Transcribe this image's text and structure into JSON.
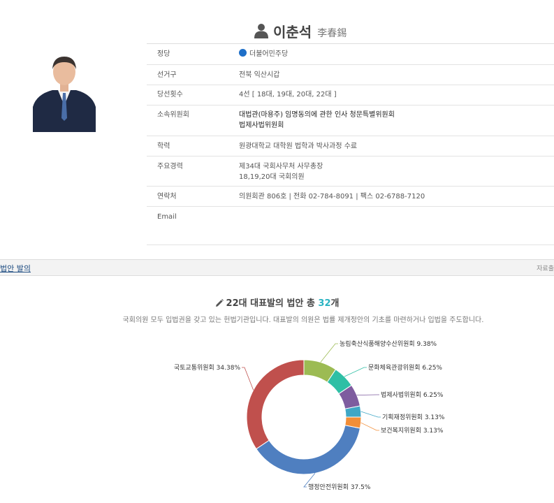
{
  "profile": {
    "name_ko": "이춘석",
    "name_hanja": "李春錫"
  },
  "info": {
    "party_label": "정당",
    "party_value": "더불어민주당",
    "party_color": "#1e6fc8",
    "district_label": "선거구",
    "district_value": "전북 익산시갑",
    "terms_label": "당선횟수",
    "terms_value": "4선 [ 18대, 19대, 20대, 22대 ]",
    "committee_label": "소속위원회",
    "committee_line1": "대법관(마용주) 임명동의에 관한 인사 청문특별위원회",
    "committee_line2": "법제사법위원회",
    "education_label": "학력",
    "education_value": "원광대학교 대학원 법학과 박사과정 수료",
    "career_label": "주요경력",
    "career_line1": "제34대 국회사무처 사무총장",
    "career_line2": "18,19,20대 국회의원",
    "contact_label": "연락처",
    "contact_value": "의원회관 806호 | 전화 02-784-8091 | 팩스 02-6788-7120",
    "email_label": "Email",
    "email_value": ""
  },
  "section": {
    "title": "법안 발의",
    "right_text": "자료출"
  },
  "bills": {
    "heading_prefix": "22대 대표발의 법안 총 ",
    "heading_count": "32",
    "heading_suffix": "개",
    "description": "국회의원 모두 입법권을 갖고 있는 헌법기관입니다. 대표발의 의원은 법률 제개정안의 기초를 마련하거나 입법을 주도합니다."
  },
  "chart_data": {
    "type": "pie",
    "donut": true,
    "title": "",
    "series": [
      {
        "label": "농림축산식품해양수산위원회",
        "value": 9.38,
        "display": "농림축산식품해양수산위원회 9.38%",
        "color": "#9cbb53"
      },
      {
        "label": "문화체육관광위원회",
        "value": 6.25,
        "display": "문화체육관광위원회 6.25%",
        "color": "#2ebfa5"
      },
      {
        "label": "법제사법위원회",
        "value": 6.25,
        "display": "법제사법위원회 6.25%",
        "color": "#7e5c9f"
      },
      {
        "label": "기획재정위원회",
        "value": 3.13,
        "display": "기획재정위원회 3.13%",
        "color": "#3fa7c6"
      },
      {
        "label": "보건복지위원회",
        "value": 3.13,
        "display": "보건복지위원회 3.13%",
        "color": "#f28e38"
      },
      {
        "label": "행정안전위원회",
        "value": 37.5,
        "display": "행정안전위원회 37.5%",
        "color": "#4f7fc0"
      },
      {
        "label": "국토교통위원회",
        "value": 34.38,
        "display": "국토교통위원회 34.38%",
        "color": "#c0504d"
      }
    ]
  }
}
